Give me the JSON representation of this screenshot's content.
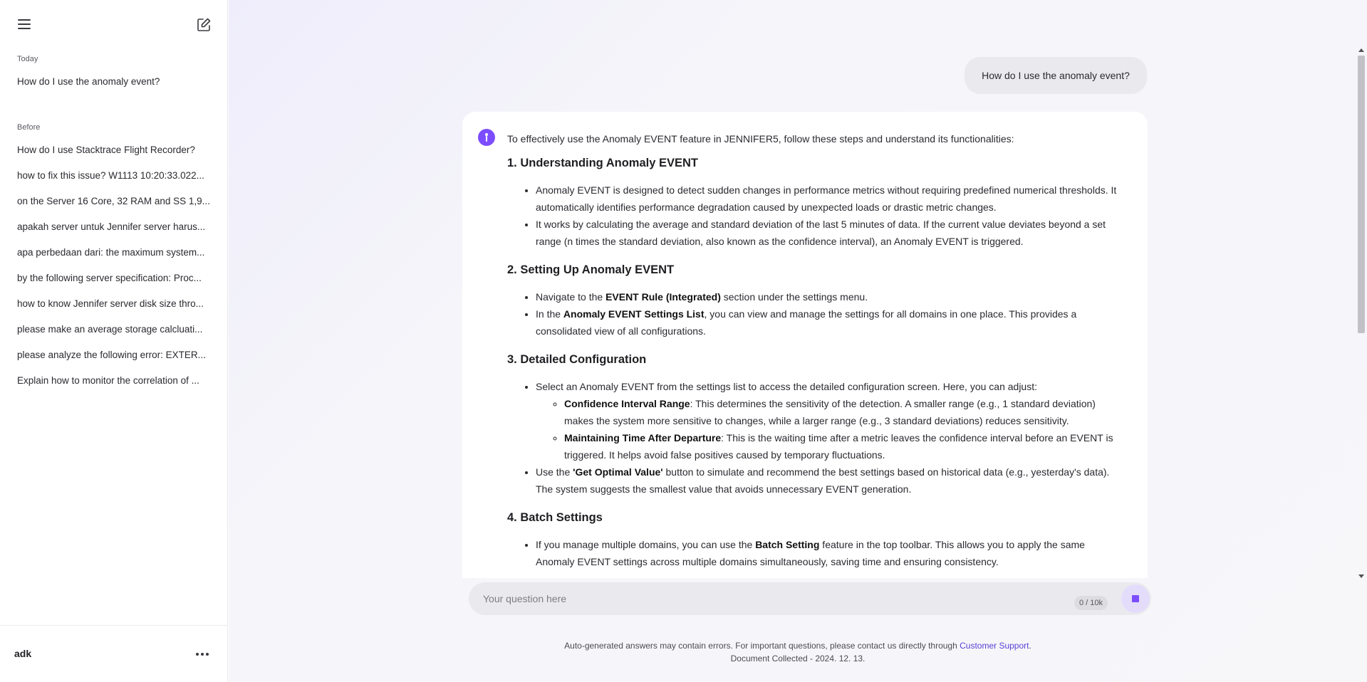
{
  "sidebar": {
    "today_label": "Today",
    "today_items": [
      "How do I use the anomaly event?"
    ],
    "before_label": "Before",
    "before_items": [
      "How do I use Stacktrace Flight Recorder?",
      "how to fix this issue? W1113 10:20:33.022...",
      "on the Server 16 Core, 32 RAM and SS 1,9...",
      "apakah server untuk Jennifer server harus...",
      "apa perbedaan dari: the maximum system...",
      "by the following server specification: Proc...",
      "how to know Jennifer server disk size thro...",
      "please make an average storage calcluati...",
      "please analyze the following error: EXTER...",
      "Explain how to monitor the correlation of ..."
    ],
    "user_name": "adk"
  },
  "chat": {
    "user_question": "How do I use the anomaly event?",
    "intro": "To effectively use the Anomaly EVENT feature in JENNIFER5, follow these steps and understand its functionalities:",
    "s1_title": "1. Understanding Anomaly EVENT",
    "s1_b1": "Anomaly EVENT is designed to detect sudden changes in performance metrics without requiring predefined numerical thresholds. It automatically identifies performance degradation caused by unexpected loads or drastic metric changes.",
    "s1_b2": "It works by calculating the average and standard deviation of the last 5 minutes of data. If the current value deviates beyond a set range (n times the standard deviation, also known as the confidence interval), an Anomaly EVENT is triggered.",
    "s2_title": "2. Setting Up Anomaly EVENT",
    "s2_b1_pre": "Navigate to the ",
    "s2_b1_bold": "EVENT Rule (Integrated)",
    "s2_b1_post": " section under the settings menu.",
    "s2_b2_pre": "In the ",
    "s2_b2_bold": "Anomaly EVENT Settings List",
    "s2_b2_post": ", you can view and manage the settings for all domains in one place. This provides a consolidated view of all configurations.",
    "s3_title": "3. Detailed Configuration",
    "s3_b1": "Select an Anomaly EVENT from the settings list to access the detailed configuration screen. Here, you can adjust:",
    "s3_sub1_bold": "Confidence Interval Range",
    "s3_sub1_post": ": This determines the sensitivity of the detection. A smaller range (e.g., 1 standard deviation) makes the system more sensitive to changes, while a larger range (e.g., 3 standard deviations) reduces sensitivity.",
    "s3_sub2_bold": "Maintaining Time After Departure",
    "s3_sub2_post": ": This is the waiting time after a metric leaves the confidence interval before an EVENT is triggered. It helps avoid false positives caused by temporary fluctuations.",
    "s3_b2_pre": "Use the ",
    "s3_b2_bold": "'Get Optimal Value'",
    "s3_b2_post": " button to simulate and recommend the best settings based on historical data (e.g., yesterday's data). The system suggests the smallest value that avoids unnecessary EVENT generation.",
    "s4_title": "4. Batch Settings",
    "s4_b1_pre": "If you manage multiple domains, you can use the ",
    "s4_b1_bold": "Batch Setting",
    "s4_b1_post": " feature in the top toolbar. This allows you to apply the same Anomaly EVENT settings across multiple domains simultaneously, saving time and ensuring consistency."
  },
  "input": {
    "placeholder": "Your question here",
    "value": "",
    "counter": "0 / 10k"
  },
  "footer": {
    "disclaimer_pre": "Auto-generated answers may contain errors. For important questions, please contact us directly through ",
    "support_link": "Customer Support",
    "disclaimer_post": ".",
    "collected": "Document Collected - 2024. 12. 13."
  },
  "colors": {
    "accent": "#7c4dff",
    "link": "#5b3fd6"
  }
}
